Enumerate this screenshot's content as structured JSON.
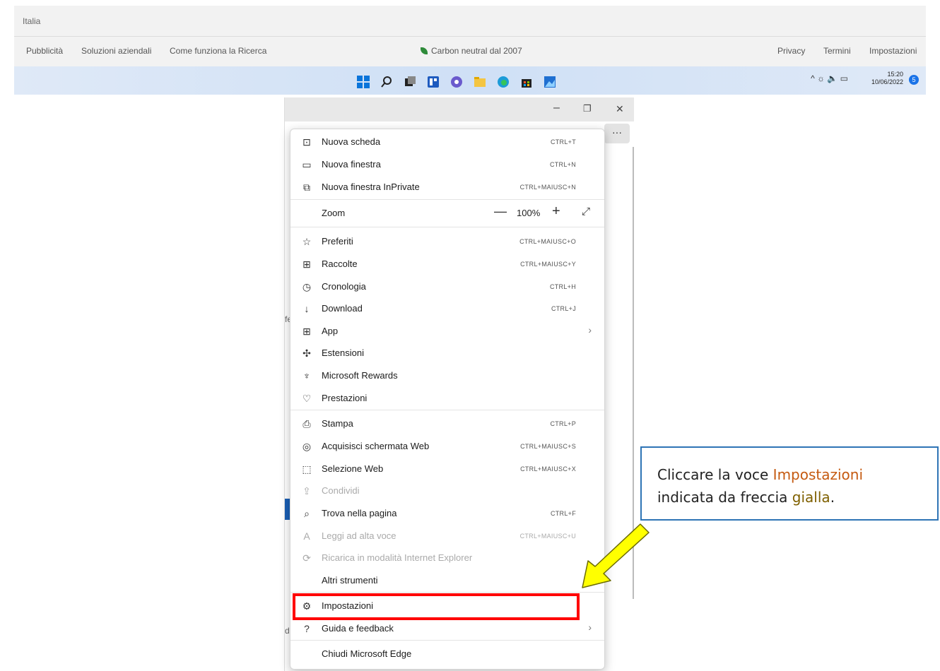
{
  "footer": {
    "country": "Italia",
    "links_left": [
      "Pubblicità",
      "Soluzioni aziendali",
      "Come funziona la Ricerca"
    ],
    "carbon": "Carbon neutral dal 2007",
    "links_right": [
      "Privacy",
      "Termini",
      "Impostazioni"
    ]
  },
  "taskbar": {
    "icons": [
      "windows-start-icon",
      "search-icon",
      "task-view-icon",
      "widgets-icon",
      "chat-icon",
      "file-explorer-icon",
      "edge-icon",
      "store-icon",
      "photos-icon"
    ],
    "tray": "^  ☼  🔈  ▭",
    "time": "15:20",
    "date": "10/06/2022",
    "notifications": "5"
  },
  "window": {
    "minimize": "–",
    "restore": "❐",
    "close": "✕",
    "more": "···"
  },
  "menu": {
    "items": [
      {
        "label": "Nuova scheda",
        "shortcut": "CTRL+T",
        "icon": "new-tab-icon",
        "glyph": "⊡"
      },
      {
        "label": "Nuova finestra",
        "shortcut": "CTRL+N",
        "icon": "new-window-icon",
        "glyph": "▭"
      },
      {
        "label": "Nuova finestra InPrivate",
        "shortcut": "CTRL+MAIUSC+N",
        "icon": "inprivate-icon",
        "glyph": "⧉"
      },
      {
        "label": "Zoom",
        "shortcut": "",
        "icon": "",
        "glyph": ""
      },
      {
        "label": "Preferiti",
        "shortcut": "CTRL+MAIUSC+O",
        "icon": "favorites-icon",
        "glyph": "☆"
      },
      {
        "label": "Raccolte",
        "shortcut": "CTRL+MAIUSC+Y",
        "icon": "collections-icon",
        "glyph": "⊞"
      },
      {
        "label": "Cronologia",
        "shortcut": "CTRL+H",
        "icon": "history-icon",
        "glyph": "◷"
      },
      {
        "label": "Download",
        "shortcut": "CTRL+J",
        "icon": "download-icon",
        "glyph": "↓"
      },
      {
        "label": "App",
        "shortcut": "",
        "icon": "apps-icon",
        "glyph": "⊞",
        "chevron": "›"
      },
      {
        "label": "Estensioni",
        "shortcut": "",
        "icon": "extensions-icon",
        "glyph": "✣"
      },
      {
        "label": "Microsoft Rewards",
        "shortcut": "",
        "icon": "rewards-icon",
        "glyph": "♆"
      },
      {
        "label": "Prestazioni",
        "shortcut": "",
        "icon": "performance-icon",
        "glyph": "♡"
      },
      {
        "label": "Stampa",
        "shortcut": "CTRL+P",
        "icon": "print-icon",
        "glyph": "⎙"
      },
      {
        "label": "Acquisisci schermata Web",
        "shortcut": "CTRL+MAIUSC+S",
        "icon": "web-capture-icon",
        "glyph": "◎"
      },
      {
        "label": "Selezione Web",
        "shortcut": "CTRL+MAIUSC+X",
        "icon": "web-select-icon",
        "glyph": "⬚"
      },
      {
        "label": "Condividi",
        "shortcut": "",
        "icon": "share-icon",
        "glyph": "⇪"
      },
      {
        "label": "Trova nella pagina",
        "shortcut": "CTRL+F",
        "icon": "find-icon",
        "glyph": "⌕"
      },
      {
        "label": "Leggi ad alta voce",
        "shortcut": "CTRL+MAIUSC+U",
        "icon": "read-aloud-icon",
        "glyph": "A"
      },
      {
        "label": "Ricarica in modalità Internet Explorer",
        "shortcut": "",
        "icon": "ie-mode-icon",
        "glyph": "⟳"
      },
      {
        "label": "Altri strumenti",
        "shortcut": "",
        "icon": "",
        "glyph": ""
      },
      {
        "label": "Impostazioni",
        "shortcut": "",
        "icon": "settings-icon",
        "glyph": "⚙"
      },
      {
        "label": "Guida e feedback",
        "shortcut": "",
        "icon": "help-icon",
        "glyph": "?",
        "chevron": "›"
      },
      {
        "label": "Chiudi Microsoft Edge",
        "shortcut": "",
        "icon": "",
        "glyph": ""
      }
    ],
    "zoom": {
      "minus": "—",
      "value": "100%",
      "plus": "+",
      "fullscreen": "⤢"
    }
  },
  "callout": {
    "line1_a": "Cliccare la voce ",
    "line1_b": "Impostazioni",
    "line2_a": "indicata da freccia ",
    "line2_b": "gialla",
    "line2_c": "."
  },
  "colors": {
    "highlight": "#ff0000",
    "arrow": "#ffff00",
    "callout_border": "#2e74b5"
  },
  "stray": {
    "fe": "fe",
    "d": "d"
  }
}
